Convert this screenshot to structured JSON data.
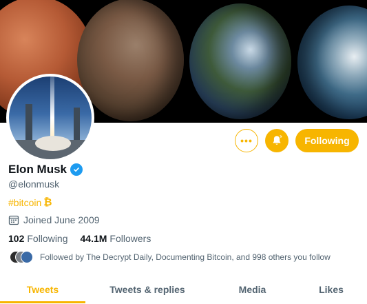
{
  "profile": {
    "name": "Elon Musk",
    "handle": "@elonmusk",
    "bio_hashtag": "#bitcoin",
    "bio_symbol": "₿",
    "joined": "Joined June 2009",
    "following_count": "102",
    "following_label": "Following",
    "followers_count": "44.1M",
    "followers_label": "Followers",
    "followed_by": "Followed by The Decrypt Daily, Documenting Bitcoin, and 998 others you follow"
  },
  "actions": {
    "more_label": "•••",
    "follow_label": "Following"
  },
  "tabs": [
    {
      "label": "Tweets",
      "active": true
    },
    {
      "label": "Tweets & replies",
      "active": false
    },
    {
      "label": "Media",
      "active": false
    },
    {
      "label": "Likes",
      "active": false
    }
  ],
  "colors": {
    "accent": "#f7b500",
    "verified": "#1d9bf0",
    "text": "#0f1419",
    "secondary_text": "#536471"
  },
  "icons": {
    "more": "more-dots-icon",
    "notify": "bell-icon",
    "verified": "verified-badge-icon",
    "calendar": "calendar-icon"
  }
}
